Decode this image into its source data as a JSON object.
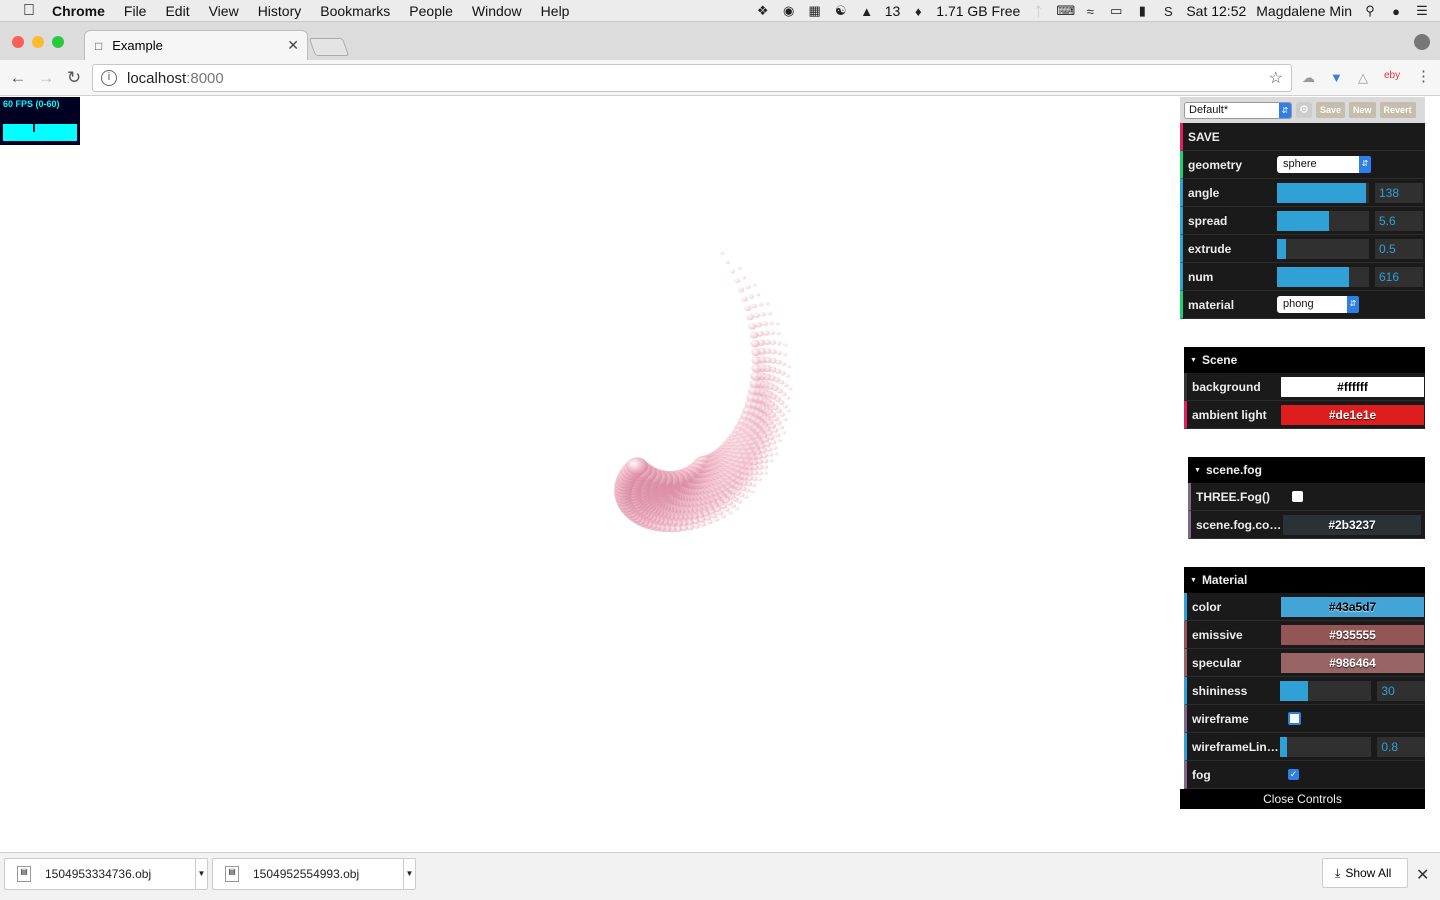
{
  "menubar": {
    "app": "Chrome",
    "items": [
      "File",
      "Edit",
      "View",
      "History",
      "Bookmarks",
      "People",
      "Window",
      "Help"
    ],
    "memory": "1.71 GB Free",
    "badge_count": "13",
    "clock": "Sat 12:52",
    "user": "Magdalene Min"
  },
  "tab": {
    "title": "Example"
  },
  "omnibox": {
    "host": "localhost",
    "port": ":8000"
  },
  "stats": {
    "fps": "60 FPS (0-60)"
  },
  "gui": {
    "preset": "Default*",
    "save_buttons": [
      "Save",
      "New",
      "Revert"
    ],
    "save_label": "SAVE",
    "controls": {
      "geometry": {
        "label": "geometry",
        "value": "sphere"
      },
      "angle": {
        "label": "angle",
        "value": "138",
        "fill": 0.97
      },
      "spread": {
        "label": "spread",
        "value": "5.6",
        "fill": 0.56
      },
      "extrude": {
        "label": "extrude",
        "value": "0.5",
        "fill": 0.1
      },
      "num": {
        "label": "num",
        "value": "616",
        "fill": 0.78
      },
      "material": {
        "label": "material",
        "value": "phong"
      }
    },
    "scene": {
      "title": "Scene",
      "background": {
        "label": "background",
        "value": "#ffffff",
        "color": "#ffffff"
      },
      "ambient": {
        "label": "ambient light",
        "value": "#de1e1e",
        "color": "#de1e1e"
      }
    },
    "fog": {
      "title": "scene.fog",
      "toggle": {
        "label": "THREE.Fog()"
      },
      "color": {
        "label": "scene.fog.color",
        "value": "#2b3237",
        "color": "#2b3237"
      }
    },
    "material": {
      "title": "Material",
      "color": {
        "label": "color",
        "value": "#43a5d7",
        "color": "#43a5d7"
      },
      "emissive": {
        "label": "emissive",
        "value": "#935555",
        "color": "#935555"
      },
      "specular": {
        "label": "specular",
        "value": "#986464",
        "color": "#986464"
      },
      "shininess": {
        "label": "shininess",
        "value": "30",
        "fill": 0.3
      },
      "wireframe": {
        "label": "wireframe"
      },
      "wireframeLinewidth": {
        "label": "wireframeLinewidth",
        "value": "0.8",
        "fill": 0.08
      },
      "fog": {
        "label": "fog"
      }
    },
    "close_label": "Close Controls"
  },
  "downloads": {
    "items": [
      "1504953334736.obj",
      "1504952554993.obj"
    ],
    "show_all": "Show All"
  }
}
